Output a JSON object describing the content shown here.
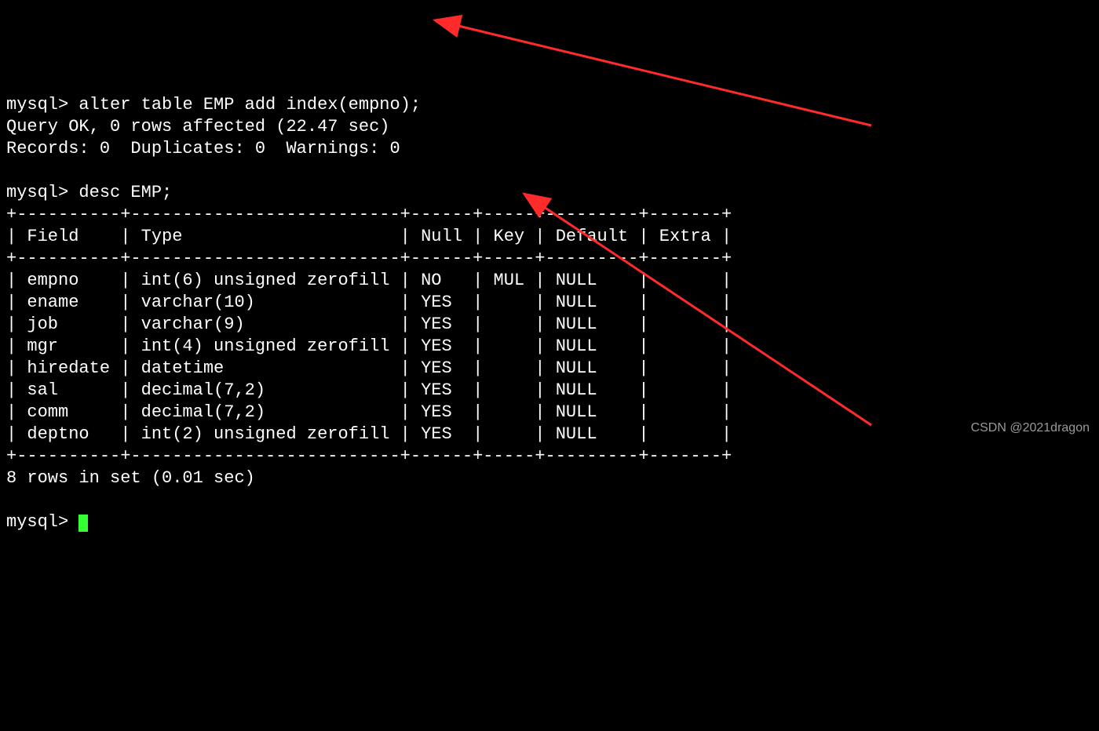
{
  "prompt": "mysql>",
  "cmd1": "alter table EMP add index(empno);",
  "cmd1_result_line1": "Query OK, 0 rows affected (22.47 sec)",
  "cmd1_result_line2": "Records: 0  Duplicates: 0  Warnings: 0",
  "cmd2": "desc EMP;",
  "table": {
    "border_top": "+----------+--------------------------+------+-----+---------+-------+",
    "header": "| Field    | Type                     | Null | Key | Default | Extra |",
    "border_mid": "+----------+--------------------------+------+-----+---------+-------+",
    "rows": [
      "| empno    | int(6) unsigned zerofill | NO   | MUL | NULL    |       |",
      "| ename    | varchar(10)              | YES  |     | NULL    |       |",
      "| job      | varchar(9)               | YES  |     | NULL    |       |",
      "| mgr      | int(4) unsigned zerofill | YES  |     | NULL    |       |",
      "| hiredate | datetime                 | YES  |     | NULL    |       |",
      "| sal      | decimal(7,2)             | YES  |     | NULL    |       |",
      "| comm     | decimal(7,2)             | YES  |     | NULL    |       |",
      "| deptno   | int(2) unsigned zerofill | YES  |     | NULL    |       |"
    ],
    "border_bot": "+----------+--------------------------+------+-----+---------+-------+"
  },
  "result2": "8 rows in set (0.01 sec)",
  "watermark": "CSDN @2021dragon",
  "chart_data": {
    "type": "table",
    "title": "desc EMP;",
    "columns": [
      "Field",
      "Type",
      "Null",
      "Key",
      "Default",
      "Extra"
    ],
    "rows": [
      [
        "empno",
        "int(6) unsigned zerofill",
        "NO",
        "MUL",
        "NULL",
        ""
      ],
      [
        "ename",
        "varchar(10)",
        "YES",
        "",
        "NULL",
        ""
      ],
      [
        "job",
        "varchar(9)",
        "YES",
        "",
        "NULL",
        ""
      ],
      [
        "mgr",
        "int(4) unsigned zerofill",
        "YES",
        "",
        "NULL",
        ""
      ],
      [
        "hiredate",
        "datetime",
        "YES",
        "",
        "NULL",
        ""
      ],
      [
        "sal",
        "decimal(7,2)",
        "YES",
        "",
        "NULL",
        ""
      ],
      [
        "comm",
        "decimal(7,2)",
        "YES",
        "",
        "NULL",
        ""
      ],
      [
        "deptno",
        "int(2) unsigned zerofill",
        "YES",
        "",
        "NULL",
        ""
      ]
    ]
  }
}
